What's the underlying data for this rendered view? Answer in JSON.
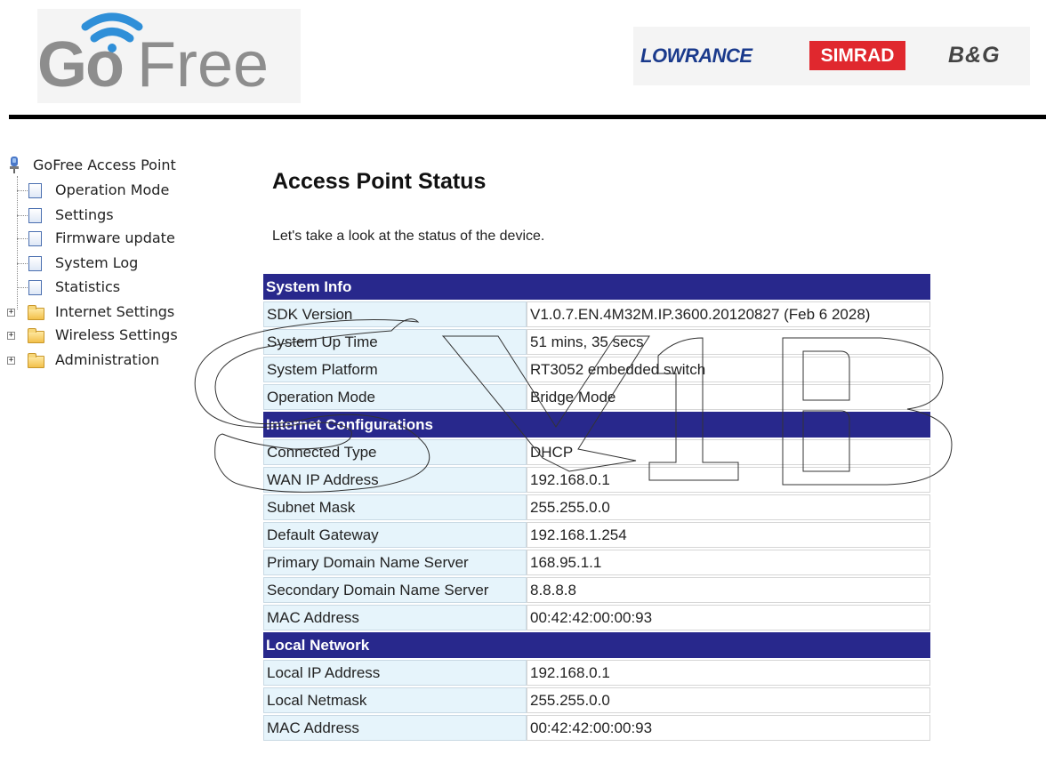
{
  "header": {
    "logo_text_go": "Go",
    "logo_text_free": "Free",
    "brands": [
      "LOWRANCE",
      "SIMRAD",
      "B&G"
    ]
  },
  "sidebar": {
    "root_label": "GoFree Access Point",
    "pages": [
      {
        "label": "Operation Mode"
      },
      {
        "label": "Settings"
      },
      {
        "label": "Firmware update"
      },
      {
        "label": "System Log"
      },
      {
        "label": "Statistics"
      }
    ],
    "folders": [
      {
        "label": "Internet Settings"
      },
      {
        "label": "Wireless Settings"
      },
      {
        "label": "Administration"
      }
    ]
  },
  "main": {
    "title": "Access Point Status",
    "intro": "Let's take a look at the status of the device.",
    "sections": [
      {
        "title": "System Info",
        "rows": [
          {
            "label": "SDK Version",
            "value": "V1.0.7.EN.4M32M.IP.3600.20120827 (Feb 6 2028)"
          },
          {
            "label": "System Up Time",
            "value": "51 mins, 35 secs"
          },
          {
            "label": "System Platform",
            "value": "RT3052 embedded switch"
          },
          {
            "label": "Operation Mode",
            "value": "Bridge Mode"
          }
        ]
      },
      {
        "title": "Internet Configurations",
        "rows": [
          {
            "label": "Connected Type",
            "value": "DHCP"
          },
          {
            "label": "WAN IP Address",
            "value": "192.168.0.1"
          },
          {
            "label": "Subnet Mask",
            "value": "255.255.0.0"
          },
          {
            "label": "Default Gateway",
            "value": "192.168.1.254"
          },
          {
            "label": "Primary Domain Name Server",
            "value": "168.95.1.1"
          },
          {
            "label": "Secondary Domain Name Server",
            "value": "8.8.8.8"
          },
          {
            "label": "MAC Address",
            "value": "00:42:42:00:00:93"
          }
        ]
      },
      {
        "title": "Local Network",
        "rows": [
          {
            "label": "Local IP Address",
            "value": "192.168.0.1"
          },
          {
            "label": "Local Netmask",
            "value": "255.255.0.0"
          },
          {
            "label": "MAC Address",
            "value": "00:42:42:00:00:93"
          }
        ]
      }
    ]
  },
  "colors": {
    "section_header": "#28288c",
    "label_cell": "#e6f4fb",
    "logo_blue": "#2f8fd8",
    "logo_grey": "#8d8d8d",
    "simrad_red": "#e0282e",
    "lowrance_blue": "#1a3a8c"
  }
}
